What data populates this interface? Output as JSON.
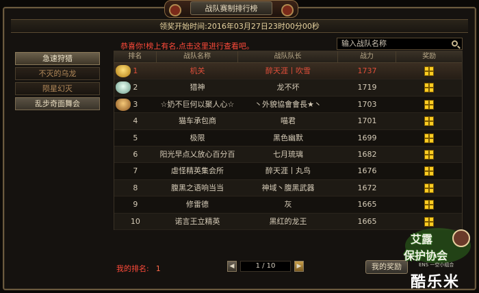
{
  "title": "战队赛制排行榜",
  "time_label": "领奖开始时间:2016年03月27日23时00分00秒",
  "sidebar": {
    "items": [
      {
        "label": "急速狩猎",
        "state": "active"
      },
      {
        "label": "不灭的乌龙",
        "state": "normal"
      },
      {
        "label": "陨星幻灭",
        "state": "normal"
      },
      {
        "label": "乱步奇面舞会",
        "state": "selected"
      }
    ]
  },
  "notice": "恭喜你!榜上有名,点击这里进行查看吧。",
  "search": {
    "placeholder": "输入战队名称"
  },
  "table": {
    "headers": {
      "rank": "排名",
      "team": "战队名称",
      "captain": "战队队长",
      "power": "战力",
      "reward": "奖励"
    },
    "rows": [
      {
        "rank": "1",
        "team": "机关",
        "captain": "醉天涯丨吹雪",
        "power": "1737",
        "medal": "gold",
        "highlight": true
      },
      {
        "rank": "2",
        "team": "猎神",
        "captain": "龙不坏",
        "power": "1719",
        "medal": "silver",
        "highlight": false
      },
      {
        "rank": "3",
        "team": "☆奶不巨何以聚人心☆",
        "captain": "丶外貌協會會長★丶",
        "power": "1703",
        "medal": "bronze",
        "highlight": false
      },
      {
        "rank": "4",
        "team": "猫车承包商",
        "captain": "喵君",
        "power": "1701",
        "medal": "",
        "highlight": false
      },
      {
        "rank": "5",
        "team": "极限",
        "captain": "黑色幽默",
        "power": "1699",
        "medal": "",
        "highlight": false
      },
      {
        "rank": "6",
        "team": "阳光早点乂放心百分百",
        "captain": "七月琉璃",
        "power": "1682",
        "medal": "",
        "highlight": false
      },
      {
        "rank": "7",
        "team": "虐怪精英集会所",
        "captain": "醉天涯丨丸鸟",
        "power": "1676",
        "medal": "",
        "highlight": false
      },
      {
        "rank": "8",
        "team": "腹黑之语响当当",
        "captain": "神域丶腹黑武器",
        "power": "1672",
        "medal": "",
        "highlight": false
      },
      {
        "rank": "9",
        "team": "修雷德",
        "captain": "灰",
        "power": "1665",
        "medal": "",
        "highlight": false
      },
      {
        "rank": "10",
        "team": "诺言王立精英",
        "captain": "黑红的龙王",
        "power": "1665",
        "medal": "",
        "highlight": false
      }
    ]
  },
  "my_rank": {
    "label": "我的排名:",
    "value": "1"
  },
  "pager": {
    "text": "1 / 10",
    "prev": "◀",
    "next": "▶"
  },
  "my_reward_label": "我的奖励",
  "watermark": {
    "line1": "艾露",
    "line2": "保护协会",
    "sub": "ENS 一空小组合",
    "brand": "酷乐米"
  },
  "colors": {
    "accent_red": "#ff4a3a",
    "gold": "#ffcc22"
  }
}
